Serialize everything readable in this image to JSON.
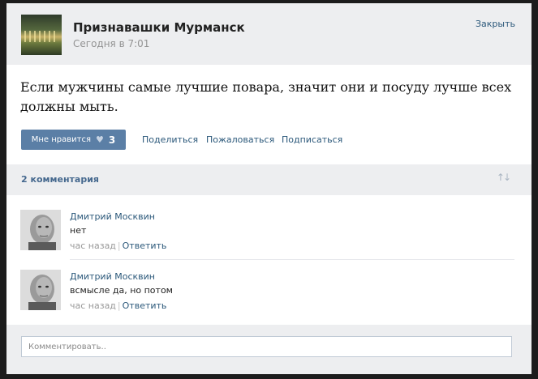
{
  "post": {
    "group_name": "Признавашки Мурманск",
    "time": "Сегодня в 7:01",
    "close_label": "Закрыть",
    "text": "Если мужчины самые лучшие повара, значит они и посуду лучше всех должны мыть.",
    "like_label": "Мне нравится",
    "like_count": "3",
    "share_label": "Поделиться",
    "report_label": "Пожаловаться",
    "subscribe_label": "Подписаться"
  },
  "comments": {
    "count_label": "2 комментария",
    "items": [
      {
        "author": "Дмитрий Москвин",
        "text": "нет",
        "time": "час назад",
        "separator": "|",
        "reply_label": "Ответить"
      },
      {
        "author": "Дмитрий Москвин",
        "text": "всмысле да, но потом",
        "time": "час назад",
        "separator": "|",
        "reply_label": "Ответить"
      }
    ]
  },
  "composer": {
    "placeholder": "Комментировать.."
  },
  "colors": {
    "accent": "#5b7fa6",
    "link": "#2b587a",
    "panel": "#edeef0"
  }
}
